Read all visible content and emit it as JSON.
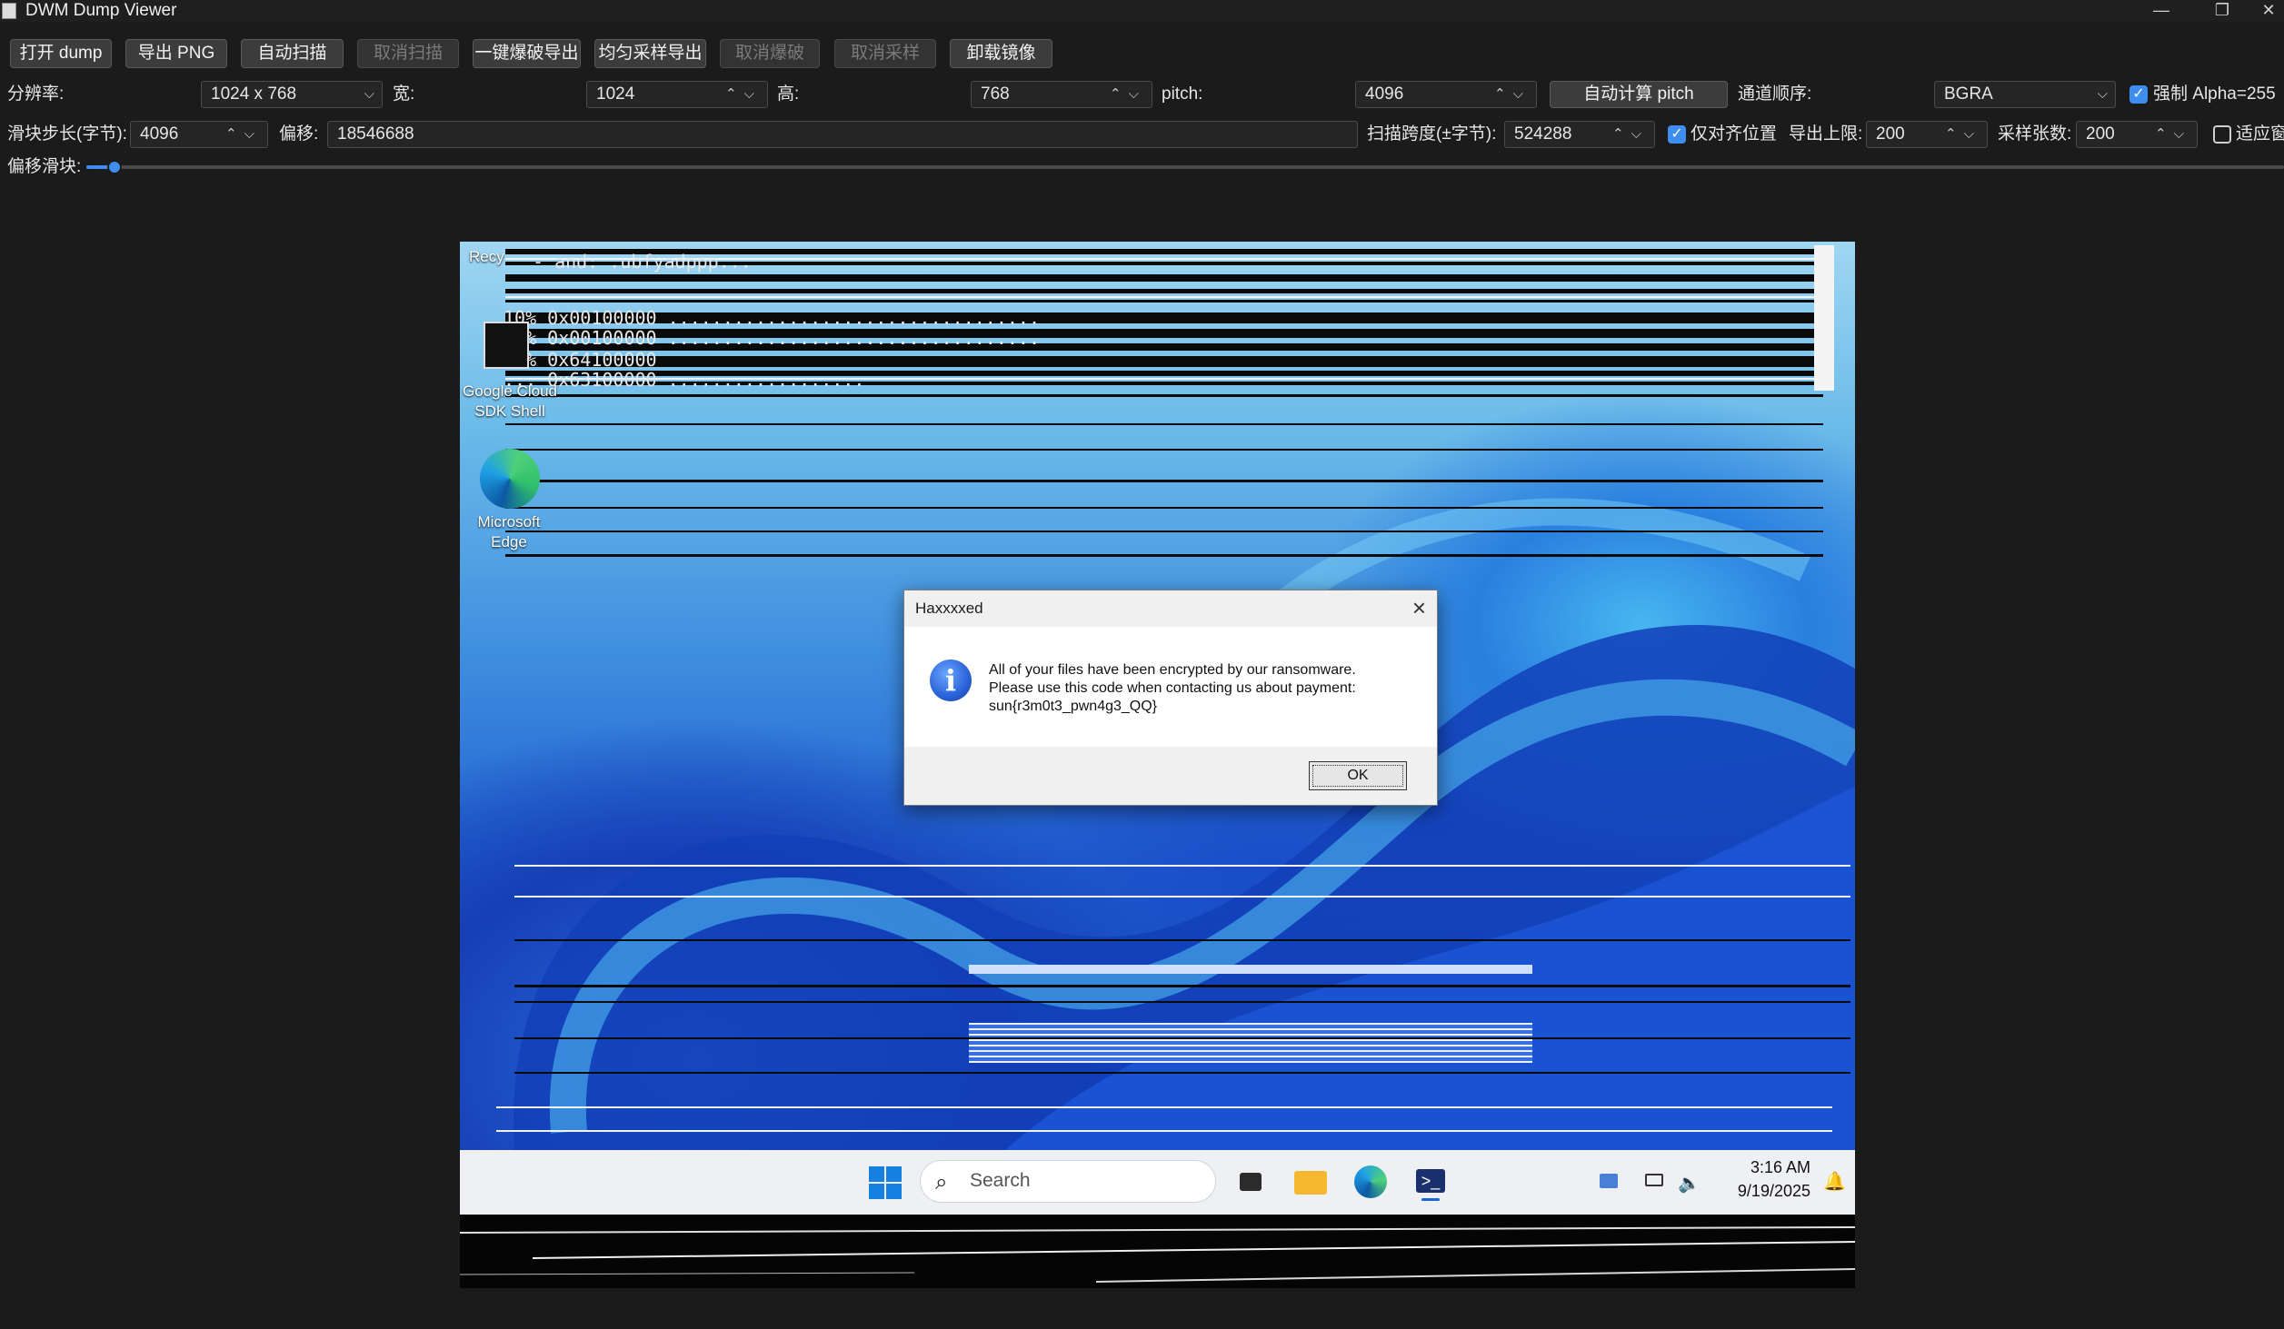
{
  "window": {
    "title": "DWM Dump Viewer",
    "min_glyph": "—",
    "restore_glyph": "❐",
    "close_glyph": "✕"
  },
  "toolbar": {
    "open_dump": "打开 dump",
    "export_png": "导出 PNG",
    "auto_scan": "自动扫描",
    "cancel_scan": "取消扫描",
    "brute_export": "一键爆破导出",
    "uniform_export": "均匀采样导出",
    "cancel_brute": "取消爆破",
    "cancel_sample": "取消采样",
    "unload_image": "卸载镜像"
  },
  "row1": {
    "resolution_label": "分辨率:",
    "resolution_value": "1024 x 768",
    "width_label": "宽:",
    "width_value": "1024",
    "height_label": "高:",
    "height_value": "768",
    "pitch_label": "pitch:",
    "pitch_value": "4096",
    "auto_pitch": "自动计算 pitch",
    "channel_label": "通道顺序:",
    "channel_value": "BGRA",
    "force_alpha_label": "强制 Alpha=255",
    "force_alpha_checked": true
  },
  "row2": {
    "step_label": "滑块步长(字节):",
    "step_value": "4096",
    "offset_label": "偏移:",
    "offset_value": "18546688",
    "span_label": "扫描跨度(±字节):",
    "span_value": "524288",
    "aligned_label": "仅对齐位置",
    "aligned_checked": true,
    "export_limit_label": "导出上限:",
    "export_limit_value": "200",
    "sample_count_label": "采样张数:",
    "sample_count_value": "200",
    "fit_label": "适应窗",
    "fit_checked": false
  },
  "slider": {
    "label": "偏移滑块:",
    "position_fraction": 0.013
  },
  "desktop": {
    "icons": [
      {
        "label": "Recy"
      },
      {
        "label": "Google Cloud SDK Shell"
      },
      {
        "label": "Microsoft Edge"
      }
    ],
    "debug_lines": [
      "- and: .ubfyadppp...",
      "10% 0x00100000 ..................................",
      "20% 0x00100000 ..................................",
      "31% 0x64100000",
      "... 0x63100000 .................."
    ]
  },
  "dialog": {
    "title": "Haxxxxed",
    "icon": "info-icon",
    "line1": "All of your files have been encrypted by our ransomware.",
    "line2": "Please use this code when contacting us about payment:",
    "line3": "sun{r3m0t3_pwn4g3_QQ}",
    "ok": "OK"
  },
  "taskbar": {
    "search_placeholder": "Search",
    "time": "3:16 AM",
    "date": "9/19/2025"
  },
  "colors": {
    "accent": "#3e8ef0",
    "background": "#1b1b1b",
    "taskbar": "#eef0f4"
  }
}
